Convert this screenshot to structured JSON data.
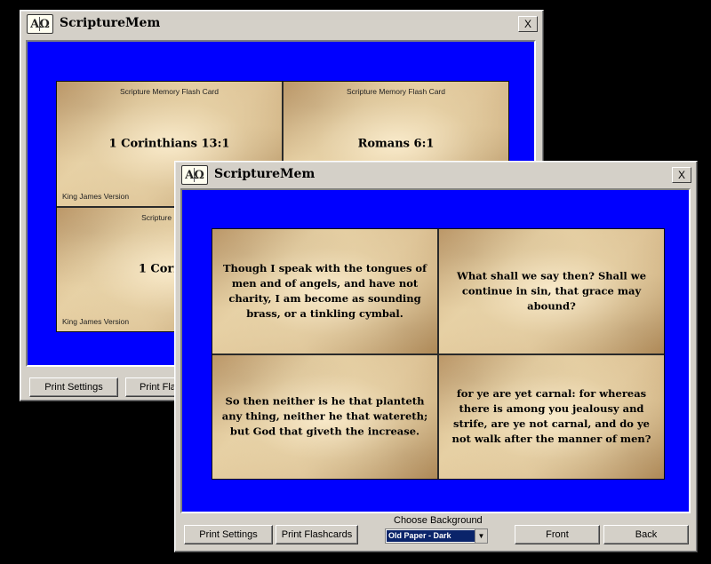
{
  "back_window": {
    "title": "ScriptureMem",
    "icon": "book-icon",
    "icon_glyph": "AΩ",
    "close_label": "X",
    "cards": [
      {
        "heading": "Scripture Memory Flash Card",
        "reference": "1 Corinthians 13:1",
        "footer": "King James Version"
      },
      {
        "heading": "Scripture Memory Flash Card",
        "reference": "Romans 6:1",
        "footer": ""
      },
      {
        "heading": "Scripture Memor",
        "reference": "1 Corinth",
        "footer": "King James Version"
      },
      {
        "heading": "",
        "reference": "",
        "footer": ""
      }
    ],
    "buttons": {
      "print_settings": "Print Settings",
      "print_flashcards": "Print Flashc"
    }
  },
  "front_window": {
    "title": "ScriptureMem",
    "icon": "book-icon",
    "icon_glyph": "AΩ",
    "close_label": "X",
    "cards": [
      {
        "text": "Though I speak with the tongues of men and of angels, and have not charity, I am become as sounding brass, or a tinkling cymbal."
      },
      {
        "text": "What shall we say then? Shall we continue in sin, that grace may abound?"
      },
      {
        "text": "So then neither is he that planteth any thing, neither he that watereth; but God that giveth the increase."
      },
      {
        "text": "for ye are yet carnal: for whereas there is among you jealousy and strife, are ye not carnal, and do ye not walk after the manner of men?"
      }
    ],
    "buttons": {
      "print_settings": "Print Settings",
      "print_flashcards": "Print Flashcards",
      "front": "Front",
      "back": "Back"
    },
    "background_label": "Choose Background",
    "background_selected": "Old Paper - Dark",
    "dropdown_arrow": "▼"
  },
  "colors": {
    "panel_blue": "#0000ff",
    "window_gray": "#d4d0c8",
    "selection_navy": "#0a246a"
  }
}
